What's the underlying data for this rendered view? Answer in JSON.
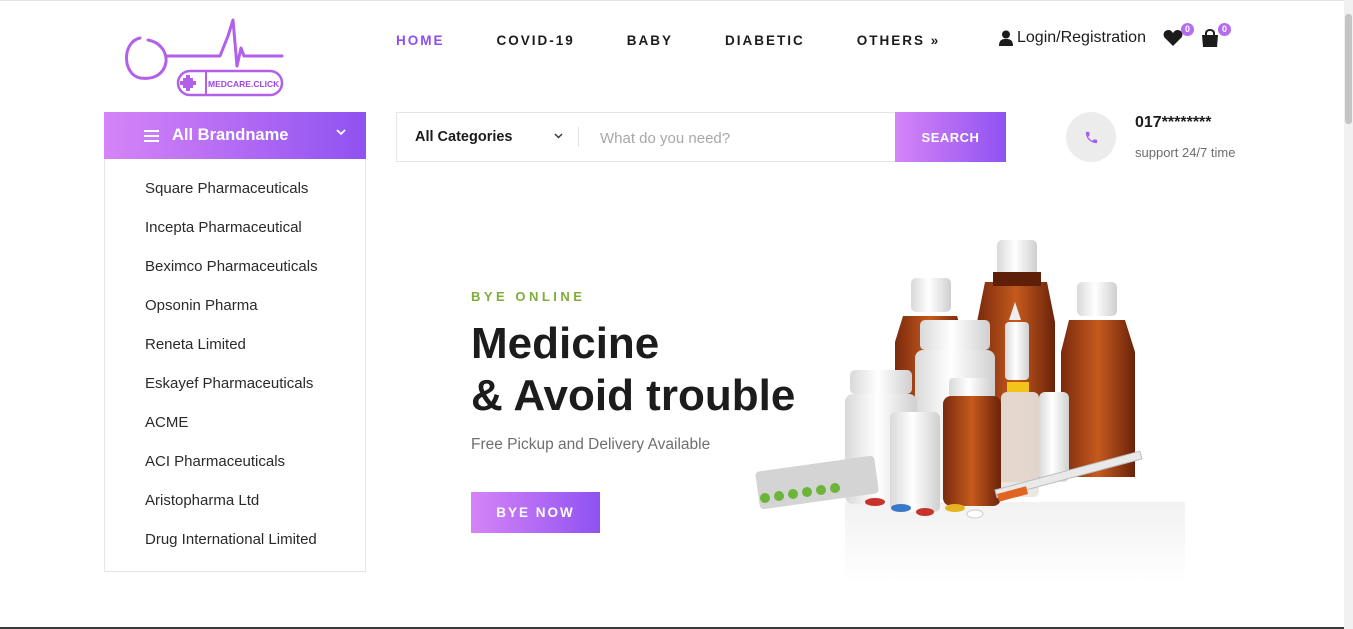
{
  "logo": {
    "text": "MEDCARE.CLICK"
  },
  "nav": {
    "items": [
      "HOME",
      "COVID-19",
      "BABY",
      "DIABETIC",
      "OTHERS »"
    ]
  },
  "account": {
    "login_label": "Login/Registration",
    "wishlist_count": "0",
    "cart_count": "0"
  },
  "brands": {
    "header": "All Brandname",
    "items": [
      "Square Pharmaceuticals",
      "Incepta Pharmaceutical",
      "Beximco Pharmaceuticals",
      "Opsonin Pharma",
      "Reneta Limited",
      "Eskayef Pharmaceuticals",
      "ACME",
      "ACI Pharmaceuticals",
      "Aristopharma Ltd",
      "Drug International Limited"
    ]
  },
  "search": {
    "category": "All Categories",
    "placeholder": "What do you need?",
    "button": "SEARCH"
  },
  "contact": {
    "phone": "017********",
    "note": "support 24/7 time"
  },
  "hero": {
    "kicker": "BYE ONLINE",
    "title_line1": "Medicine",
    "title_line2": "& Avoid trouble",
    "subtitle": "Free Pickup and Delivery Available",
    "cta": "BYE NOW"
  },
  "colors": {
    "accent_start": "#d684f7",
    "accent_end": "#8f52f1",
    "kicker": "#7fad39"
  }
}
